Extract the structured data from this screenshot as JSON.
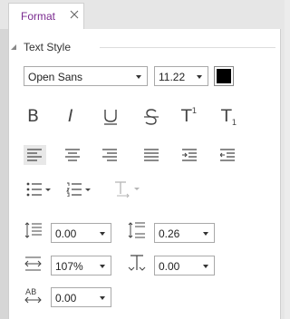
{
  "tab": {
    "label": "Format"
  },
  "section": {
    "title": "Text Style"
  },
  "font": {
    "family": "Open Sans",
    "size": "11.22",
    "color": "#000000"
  },
  "spacing": {
    "line_spacing": "0.00",
    "paragraph_spacing": "0.26",
    "char_scale": "107%",
    "baseline_offset": "0.00",
    "letter_spacing": "0.00"
  },
  "colors": {
    "accent": "#7a2a8f",
    "icon": "#555555",
    "disabled_icon": "#b5b5b5"
  }
}
